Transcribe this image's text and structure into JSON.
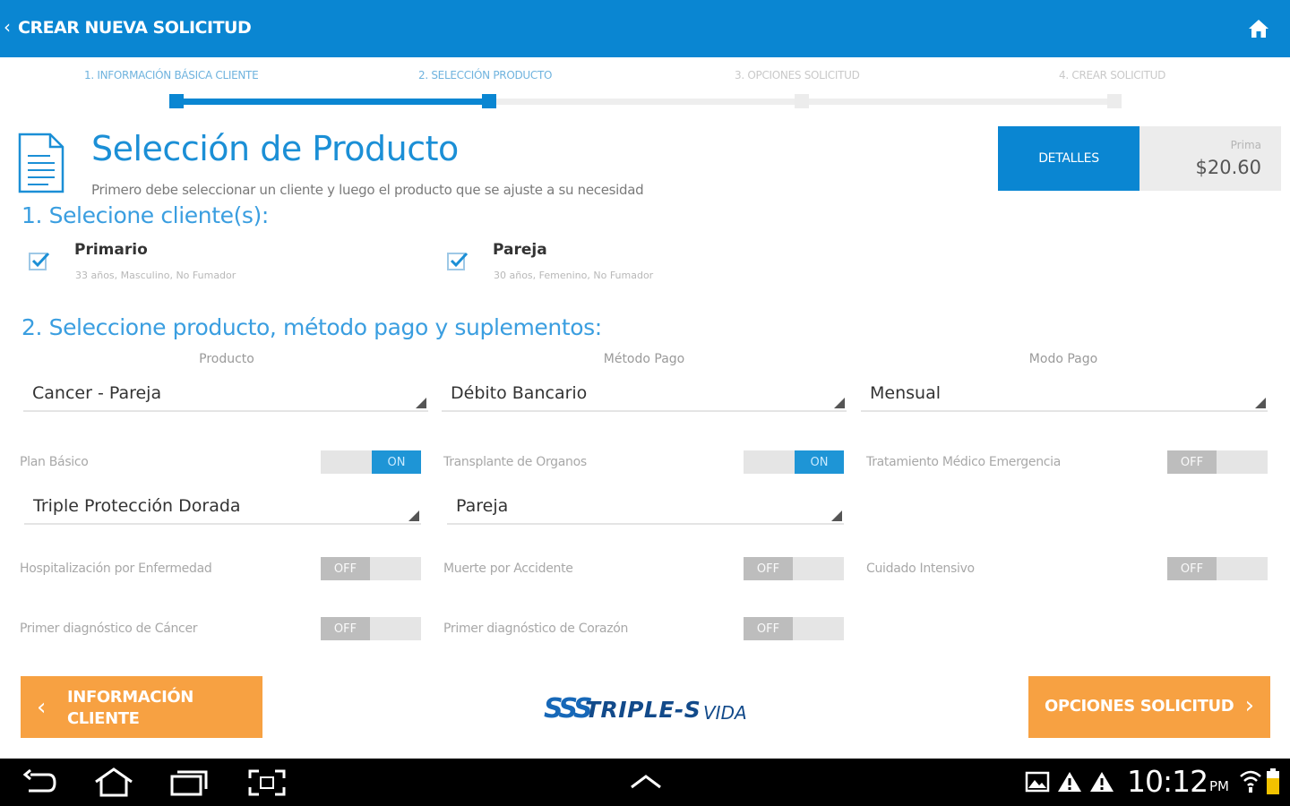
{
  "topbar": {
    "back_glyph": "‹",
    "title": "CREAR NUEVA SOLICITUD",
    "home_icon": "home-icon"
  },
  "stepper": {
    "steps": [
      {
        "label": "1. INFORMACIÓN BÁSICA CLIENTE",
        "active": true
      },
      {
        "label": "2. SELECCIÓN PRODUCTO",
        "active": true
      },
      {
        "label": "3. OPCIONES SOLICITUD",
        "active": false
      },
      {
        "label": "4. CREAR SOLICITUD",
        "active": false
      }
    ],
    "progress_fraction": 0.333
  },
  "header": {
    "title": "Selección de Producto",
    "subtitle": "Primero debe seleccionar un cliente y luego el producto que se ajuste a su necesidad",
    "details_label": "DETALLES",
    "prima_label": "Prima",
    "prima_value": "$20.60"
  },
  "clients_section": {
    "heading": "1. Selecione cliente(s):",
    "clients": [
      {
        "name": "Primario",
        "meta": "33 años, Masculino, No Fumador",
        "checked": true
      },
      {
        "name": "Pareja",
        "meta": "30 años, Femenino, No Fumador",
        "checked": true
      }
    ]
  },
  "product_section": {
    "heading": "2. Seleccione producto, método pago y suplementos:",
    "columns": [
      "Producto",
      "Método Pago",
      "Modo Pago"
    ],
    "selects": [
      "Cancer - Pareja",
      "Débito Bancario",
      "Mensual"
    ],
    "sub_selects": [
      "Triple Protección Dorada",
      "Pareja"
    ],
    "options": [
      {
        "label": "Plan Básico",
        "state": "ON"
      },
      {
        "label": "Transplante de Organos",
        "state": "ON"
      },
      {
        "label": "Tratamiento Médico Emergencia",
        "state": "OFF"
      },
      {
        "label": "Hospitalización por Enfermedad",
        "state": "OFF"
      },
      {
        "label": "Muerte por Accidente",
        "state": "OFF"
      },
      {
        "label": "Cuidado Intensivo",
        "state": "OFF"
      },
      {
        "label": "Primer diagnóstico de Cáncer",
        "state": "OFF"
      },
      {
        "label": "Primer diagnóstico de Corazón",
        "state": "OFF"
      }
    ]
  },
  "footer": {
    "prev_label_1": "INFORMACIÓN",
    "prev_label_2": "CLIENTE",
    "next_label": "OPCIONES SOLICITUD",
    "logo_mark": "SSS",
    "logo_name": "TRIPLE-S",
    "logo_vida": "VIDA"
  },
  "system_bar": {
    "time": "10:12",
    "ampm": "PM"
  },
  "colors": {
    "primary": "#0a86d2",
    "accent": "#f7a142",
    "toggle_on": "#1e95d6",
    "toggle_off": "#bdbdbd"
  }
}
